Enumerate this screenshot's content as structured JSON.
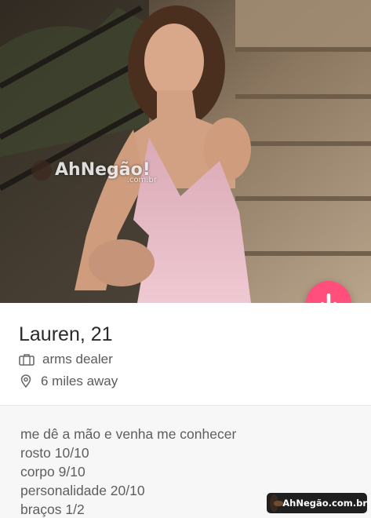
{
  "profile": {
    "name_age": "Lauren, 21",
    "job": "arms dealer",
    "distance": "6 miles away"
  },
  "bio": {
    "lines": [
      "me dê a mão e venha me conhecer",
      "rosto 10/10",
      "corpo 9/10",
      "personalidade 20/10",
      "braços 1/2"
    ]
  },
  "watermark": {
    "photo_brand": "AhNegão!",
    "photo_domain": ".com.br",
    "footer_brand": "AhNegão.com.br"
  },
  "icons": {
    "fab": "arrow-down-icon",
    "job": "briefcase-icon",
    "distance": "location-pin-icon"
  },
  "colors": {
    "fab": "#ff4f7a",
    "dress": "#e7b8c3",
    "bio_background": "#f7f7f7"
  }
}
